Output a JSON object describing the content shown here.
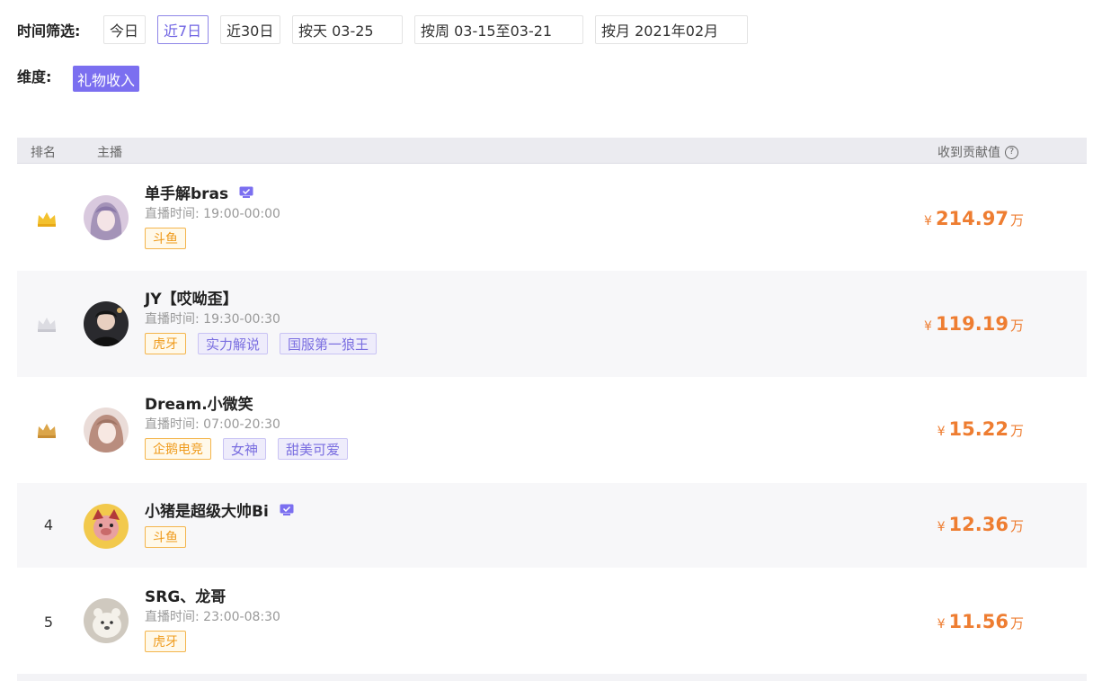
{
  "filters": {
    "time_label": "时间筛选:",
    "buttons": [
      "今日",
      "近7日",
      "近30日",
      "按天 03-25",
      "按周 03-15至03-21",
      "按月 2021年02月"
    ],
    "active_index": 1,
    "dimension_label": "维度:",
    "dimension_value": "礼物收入"
  },
  "table": {
    "col_rank": "排名",
    "col_anchor": "主播",
    "col_value": "收到贡献值",
    "help_glyph": "?",
    "currency": "¥",
    "unit": "万"
  },
  "rows": [
    {
      "rank": "1",
      "crown": "gold",
      "name": "单手解bras",
      "verified": true,
      "time": "直播时间:  19:00-00:00",
      "platform": "斗鱼",
      "labels": [],
      "value": "214.97"
    },
    {
      "rank": "2",
      "crown": "silver",
      "name": "JY【哎呦歪】",
      "verified": false,
      "time": "直播时间:  19:30-00:30",
      "platform": "虎牙",
      "labels": [
        "实力解说",
        "国服第一狼王"
      ],
      "value": "119.19"
    },
    {
      "rank": "3",
      "crown": "bronze",
      "name": "Dream.小微笑",
      "verified": false,
      "time": "直播时间:  07:00-20:30",
      "platform": "企鹅电竞",
      "labels": [
        "女神",
        "甜美可爱"
      ],
      "value": "15.22"
    },
    {
      "rank": "4",
      "crown": null,
      "name": "小猪是超级大帅Bi",
      "verified": true,
      "time": "",
      "platform": "斗鱼",
      "labels": [],
      "value": "12.36"
    },
    {
      "rank": "5",
      "crown": null,
      "name": "SRG、龙哥",
      "verified": false,
      "time": "直播时间:  23:00-08:30",
      "platform": "虎牙",
      "labels": [],
      "value": "11.56"
    }
  ],
  "colors": {
    "accent": "#7b6ff0",
    "value": "#ee7d31",
    "crown_gold": "#f3c12e",
    "crown_silver": "#d8d8de",
    "crown_bronze": "#dba54a"
  }
}
